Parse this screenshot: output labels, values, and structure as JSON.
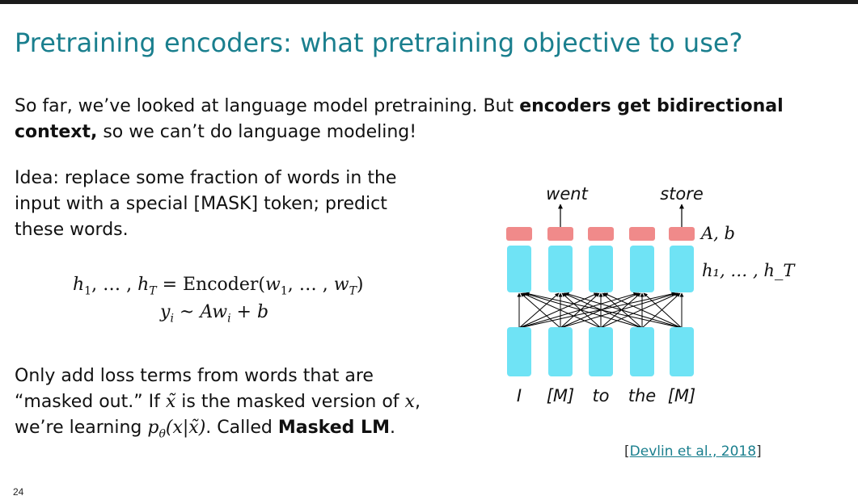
{
  "title": "Pretraining encoders: what pretraining objective to use?",
  "intro": {
    "part1": "So far, we’ve looked at language model pretraining. But ",
    "bold": "encoders get bidirectional context,",
    "part2": " so we can’t do language modeling!"
  },
  "idea": {
    "text": "Idea: replace some fraction of words in the input with a special [MASK]  token; predict these words."
  },
  "equations": {
    "line1": "h₁, … , h_T = Encoder(w₁, … , w_T)",
    "line2": "y_i ~ Aw_i + b"
  },
  "loss": {
    "part1": "Only add loss terms from words that are “masked out.” If ",
    "xtilde": "x̃",
    "part2": " is the masked version of ",
    "x": "x",
    "part3": ", we’re learning ",
    "prob": "p_θ(x|x̃)",
    "part4": ". Called ",
    "bold": "Masked LM",
    "part5": "."
  },
  "diagram": {
    "output_words": [
      "went",
      "store"
    ],
    "input_words": [
      "I",
      "[M]",
      "to",
      "the",
      "[M]"
    ],
    "head_label": "A, b",
    "hidden_label": "h₁, … , h_T",
    "colors": {
      "head": "#f08a8a",
      "cell": "#6fe3f5",
      "arrows": "#000000"
    }
  },
  "citation": {
    "open": "[",
    "text": "Devlin et al., 2018",
    "close": "]"
  },
  "slide_number": "24"
}
